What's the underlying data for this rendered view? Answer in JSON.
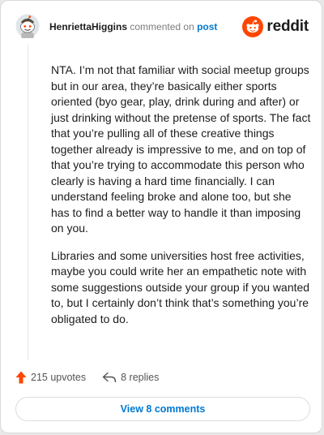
{
  "comment": {
    "username": "HenriettaHiggins",
    "action_text": "commented on",
    "post_link": "post",
    "paragraphs": [
      "NTA. I’m not that familiar with social meetup groups but in our area, they’re basically either sports oriented (byo gear, play, drink during and after) or just drinking without the pretense of sports. The fact that you’re pulling all of these creative things together already is impressive to me, and on top of that you’re trying to accommodate this person who clearly is having a hard time financially. I can understand feeling broke and alone too, but she has to find a better way to handle it than imposing on you.",
      "Libraries and some universities host free activities, maybe you could write her an empathetic note with some suggestions outside your group if you wanted to, but I certainly don’t think that’s something you’re obligated to do."
    ],
    "upvotes_label": "215 upvotes",
    "replies_label": "8 replies",
    "view_comments_label": "View 8 comments"
  },
  "brand": {
    "wordmark": "reddit",
    "color": "#ff4500"
  },
  "icons": {
    "avatar": "snoo-avatar",
    "brand": "reddit-logo-icon",
    "upvote": "upvote-arrow-icon",
    "reply": "reply-arrow-icon"
  },
  "colors": {
    "link": "#0079d3",
    "upvote": "#ff4500",
    "text": "#1c1c1c",
    "muted": "#7c7c7c"
  }
}
